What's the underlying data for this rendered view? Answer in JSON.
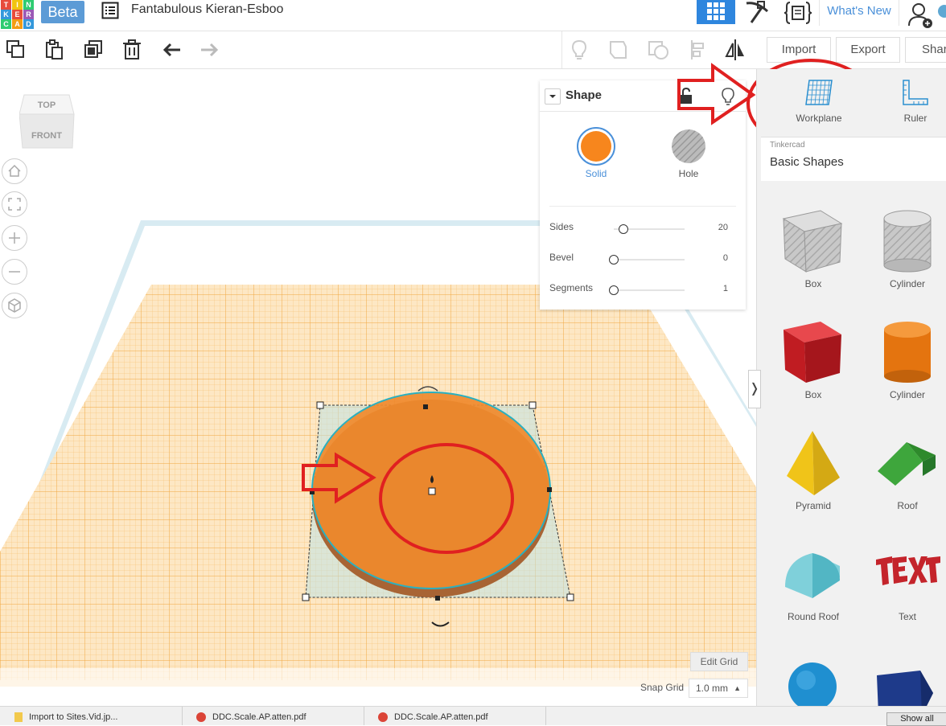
{
  "app": {
    "logo_letters": [
      "T",
      "I",
      "N",
      "K",
      "E",
      "R",
      "C",
      "A",
      "D"
    ],
    "beta_label": "Beta",
    "design_title": "Fantabulous Kieran-Esboo",
    "whats_new": "What's New"
  },
  "toolbar": {
    "import_label": "Import",
    "export_label": "Export",
    "share_label": "Shar"
  },
  "inspector": {
    "title": "Shape",
    "solid_label": "Solid",
    "hole_label": "Hole",
    "solid_color": "#f7861d",
    "params": [
      {
        "label": "Sides",
        "value": "20",
        "level": 0.14
      },
      {
        "label": "Bevel",
        "value": "0",
        "level": 0.0
      },
      {
        "label": "Segments",
        "value": "1",
        "level": 0.0
      }
    ]
  },
  "panel": {
    "workplane_label": "Workplane",
    "ruler_label": "Ruler",
    "library_category": "Tinkercad",
    "library_name": "Basic Shapes",
    "shapes": [
      {
        "label": "Box",
        "icon": "box-hole-icon"
      },
      {
        "label": "Cylinder",
        "icon": "cylinder-hole-icon"
      },
      {
        "label": "Box",
        "icon": "box-icon"
      },
      {
        "label": "Cylinder",
        "icon": "cylinder-icon"
      },
      {
        "label": "Pyramid",
        "icon": "pyramid-icon"
      },
      {
        "label": "Roof",
        "icon": "roof-icon"
      },
      {
        "label": "Round Roof",
        "icon": "round-roof-icon"
      },
      {
        "label": "Text",
        "icon": "text-icon"
      }
    ]
  },
  "viewport": {
    "cube_top": "TOP",
    "cube_front": "FRONT",
    "edit_grid": "Edit Grid",
    "snap_grid_label": "Snap Grid",
    "snap_grid_value": "1.0 mm",
    "grid_color": "#f5a623",
    "shape_color": "#f08a2c",
    "annotation_color": "#e02020"
  },
  "statusbar": {
    "items": [
      "Import to Sites.Vid.jp...",
      "DDC.Scale.AP.atten.pdf",
      "DDC.Scale.AP.atten.pdf"
    ],
    "show_all": "Show all"
  }
}
